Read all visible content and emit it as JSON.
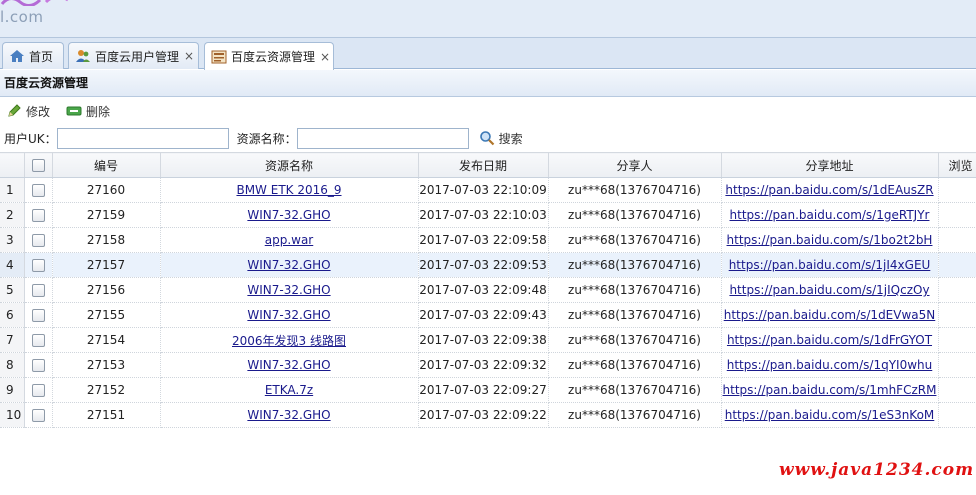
{
  "banner": {
    "logo_text": "l.com"
  },
  "tabs": [
    {
      "label": "首页",
      "icon": "home-icon",
      "closable": false
    },
    {
      "label": "百度云用户管理",
      "icon": "users-icon",
      "closable": true
    },
    {
      "label": "百度云资源管理",
      "icon": "resource-icon",
      "closable": true,
      "active": true
    }
  ],
  "tab_close_glyph": "×",
  "panel": {
    "title": "百度云资源管理"
  },
  "toolbar": {
    "edit_label": "修改",
    "delete_label": "删除"
  },
  "search": {
    "user_uk_label": "用户UK：",
    "user_uk_value": "",
    "resource_name_label": "资源名称：",
    "resource_name_value": "",
    "search_label": "搜索"
  },
  "grid": {
    "columns": [
      "编号",
      "资源名称",
      "发布日期",
      "分享人",
      "分享地址",
      "浏览"
    ],
    "rows": [
      {
        "num": "1",
        "id": "27160",
        "name": "BMW ETK 2016_9",
        "date": "2017-07-03 22:10:09",
        "sharer": "zu***68(1376704716)",
        "url": "https://pan.baidu.com/s/1dEAusZR"
      },
      {
        "num": "2",
        "id": "27159",
        "name": "WIN7-32.GHO",
        "date": "2017-07-03 22:10:03",
        "sharer": "zu***68(1376704716)",
        "url": "https://pan.baidu.com/s/1geRTJYr"
      },
      {
        "num": "3",
        "id": "27158",
        "name": "app.war",
        "date": "2017-07-03 22:09:58",
        "sharer": "zu***68(1376704716)",
        "url": "https://pan.baidu.com/s/1bo2t2bH"
      },
      {
        "num": "4",
        "id": "27157",
        "name": "WIN7-32.GHO",
        "date": "2017-07-03 22:09:53",
        "sharer": "zu***68(1376704716)",
        "url": "https://pan.baidu.com/s/1jI4xGEU",
        "highlight": true
      },
      {
        "num": "5",
        "id": "27156",
        "name": "WIN7-32.GHO",
        "date": "2017-07-03 22:09:48",
        "sharer": "zu***68(1376704716)",
        "url": "https://pan.baidu.com/s/1jIQczOy"
      },
      {
        "num": "6",
        "id": "27155",
        "name": "WIN7-32.GHO",
        "date": "2017-07-03 22:09:43",
        "sharer": "zu***68(1376704716)",
        "url": "https://pan.baidu.com/s/1dEVwa5N"
      },
      {
        "num": "7",
        "id": "27154",
        "name": "2006年发现3 线路图",
        "date": "2017-07-03 22:09:38",
        "sharer": "zu***68(1376704716)",
        "url": "https://pan.baidu.com/s/1dFrGYOT"
      },
      {
        "num": "8",
        "id": "27153",
        "name": "WIN7-32.GHO",
        "date": "2017-07-03 22:09:32",
        "sharer": "zu***68(1376704716)",
        "url": "https://pan.baidu.com/s/1qYI0whu"
      },
      {
        "num": "9",
        "id": "27152",
        "name": "ETKA.7z",
        "date": "2017-07-03 22:09:27",
        "sharer": "zu***68(1376704716)",
        "url": "https://pan.baidu.com/s/1mhFCzRM"
      },
      {
        "num": "10",
        "id": "27151",
        "name": "WIN7-32.GHO",
        "date": "2017-07-03 22:09:22",
        "sharer": "zu***68(1376704716)",
        "url": "https://pan.baidu.com/s/1eS3nKoM"
      }
    ]
  },
  "watermark": "www.java1234.com",
  "colors": {
    "accent": "#1a1a8c",
    "watermark": "#e01111",
    "highlight_row": "#eaf2fc"
  }
}
